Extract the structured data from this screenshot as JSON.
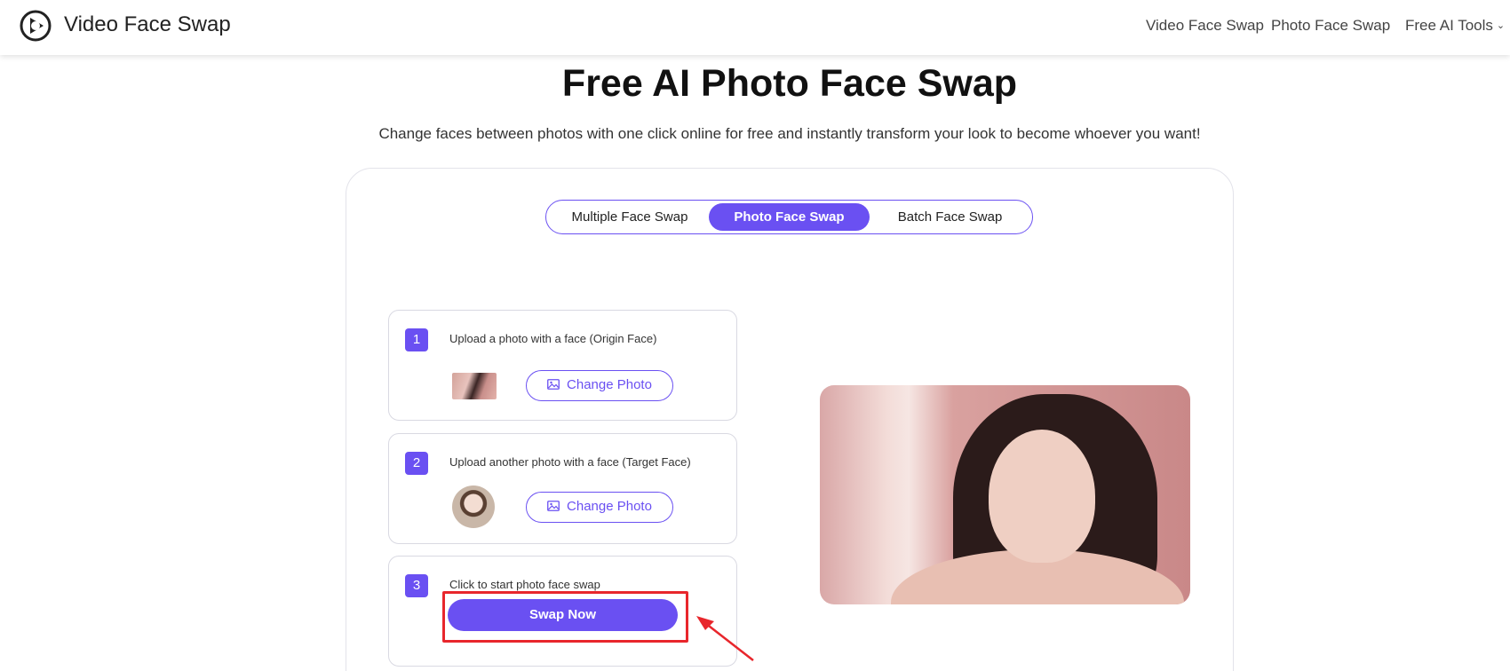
{
  "header": {
    "brand": "Video Face Swap",
    "nav": [
      "Video Face Swap",
      "Photo Face Swap",
      "Free AI Tools"
    ]
  },
  "hero": {
    "title": "Free AI Photo Face Swap",
    "subtitle": "Change faces between photos with one click online for free and instantly transform your look to become whoever you want!"
  },
  "tabs": [
    "Multiple Face Swap",
    "Photo Face Swap",
    "Batch Face Swap"
  ],
  "steps": [
    {
      "number": "1",
      "text": "Upload a photo with a face  (Origin Face)",
      "button": "Change Photo"
    },
    {
      "number": "2",
      "text": "Upload another photo with a face  (Target Face)",
      "button": "Change Photo"
    },
    {
      "number": "3",
      "text": "Click to start photo face swap",
      "button": "Swap Now"
    }
  ],
  "colors": {
    "accent": "#6a50f2",
    "highlight": "#e8262c"
  }
}
